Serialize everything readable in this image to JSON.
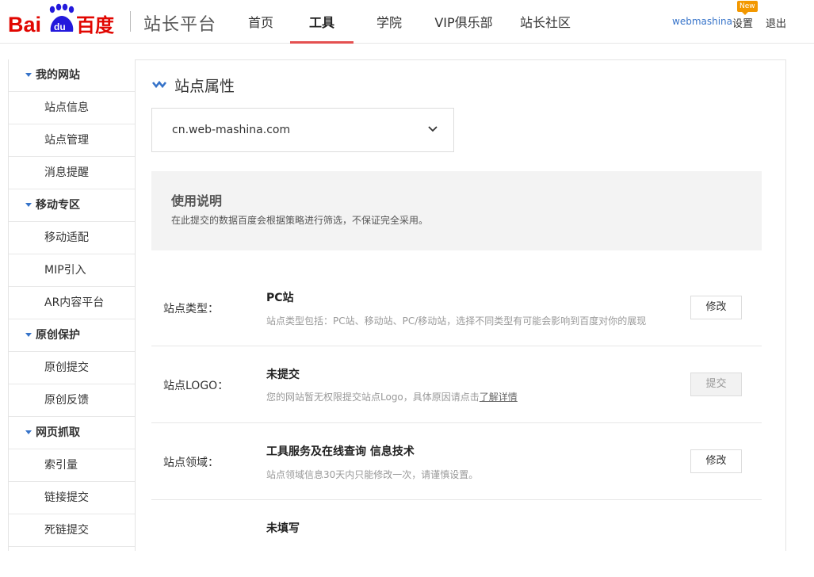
{
  "header": {
    "logo_text": "Bai du 百度",
    "platform_title": "站长平台",
    "nav": [
      {
        "label": "首页",
        "active": false
      },
      {
        "label": "工具",
        "active": true
      },
      {
        "label": "学院",
        "active": false
      },
      {
        "label": "VIP俱乐部",
        "active": false
      },
      {
        "label": "站长社区",
        "active": false
      }
    ],
    "username": "webmashina",
    "new_badge": "New",
    "settings": "设置",
    "logout": "退出"
  },
  "sidebar": {
    "groups": [
      {
        "label": "我的网站",
        "items": [
          "站点信息",
          "站点管理",
          "消息提醒"
        ]
      },
      {
        "label": "移动专区",
        "items": [
          "移动适配",
          "MIP引入",
          "AR内容平台"
        ]
      },
      {
        "label": "原创保护",
        "items": [
          "原创提交",
          "原创反馈"
        ]
      },
      {
        "label": "网页抓取",
        "items": [
          "索引量",
          "链接提交",
          "死链提交"
        ]
      }
    ]
  },
  "main": {
    "title": "站点属性",
    "site_select": {
      "value": "cn.web-mashina.com"
    },
    "notice": {
      "title": "使用说明",
      "text": "在此提交的数据百度会根据策略进行筛选，不保证完全采用。"
    },
    "rows": [
      {
        "label": "站点类型：",
        "value": "PC站",
        "desc": "站点类型包括：PC站、移动站、PC/移动站，选择不同类型有可能会影响到百度对你的展现",
        "desc_link": "",
        "button": "修改",
        "disabled": false
      },
      {
        "label": "站点LOGO：",
        "value": "未提交",
        "desc": "您的网站暂无权限提交站点Logo，具体原因请点击",
        "desc_link": "了解详情",
        "button": "提交",
        "disabled": true
      },
      {
        "label": "站点领域：",
        "value": "工具服务及在线查询 信息技术",
        "desc": "站点领域信息30天内只能修改一次，请谨慎设置。",
        "desc_link": "",
        "button": "修改",
        "disabled": false
      },
      {
        "label": "",
        "value": "未填写",
        "desc": "",
        "desc_link": "",
        "button": "",
        "disabled": false
      }
    ]
  },
  "colors": {
    "accent_red": "#e45050",
    "link_blue": "#3673c9",
    "badge_orange": "#f39800"
  }
}
